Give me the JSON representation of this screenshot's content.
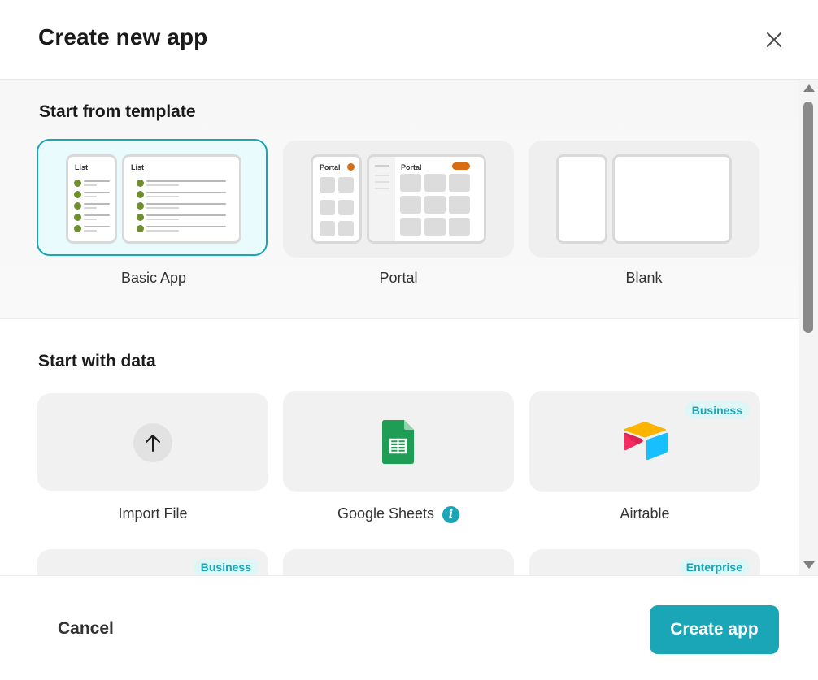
{
  "dialog": {
    "title": "Create new app",
    "close_icon": "close-icon"
  },
  "templates": {
    "section_title": "Start from template",
    "items": [
      {
        "label": "Basic App",
        "selected": true,
        "preview_text": "List"
      },
      {
        "label": "Portal",
        "selected": false,
        "preview_text": "Portal"
      },
      {
        "label": "Blank",
        "selected": false
      }
    ]
  },
  "data_sources": {
    "section_title": "Start with data",
    "items": [
      {
        "label": "Import File",
        "icon": "upload-arrow-icon"
      },
      {
        "label": "Google Sheets",
        "icon": "google-sheets-icon",
        "info_icon": "info-icon"
      },
      {
        "label": "Airtable",
        "icon": "airtable-icon",
        "badge": "Business"
      },
      {
        "label": "",
        "badge": "Business"
      },
      {
        "label": ""
      },
      {
        "label": "",
        "badge": "Enterprise"
      }
    ]
  },
  "footer": {
    "cancel_label": "Cancel",
    "create_label": "Create app"
  },
  "colors": {
    "accent": "#1aa6b7",
    "badge_bg": "#dff6f6",
    "selected_bg": "#e9fbfd",
    "list_dot": "#6f8e2e",
    "portal_orange": "#d96b12",
    "sheets_green": "#1f9d55"
  }
}
